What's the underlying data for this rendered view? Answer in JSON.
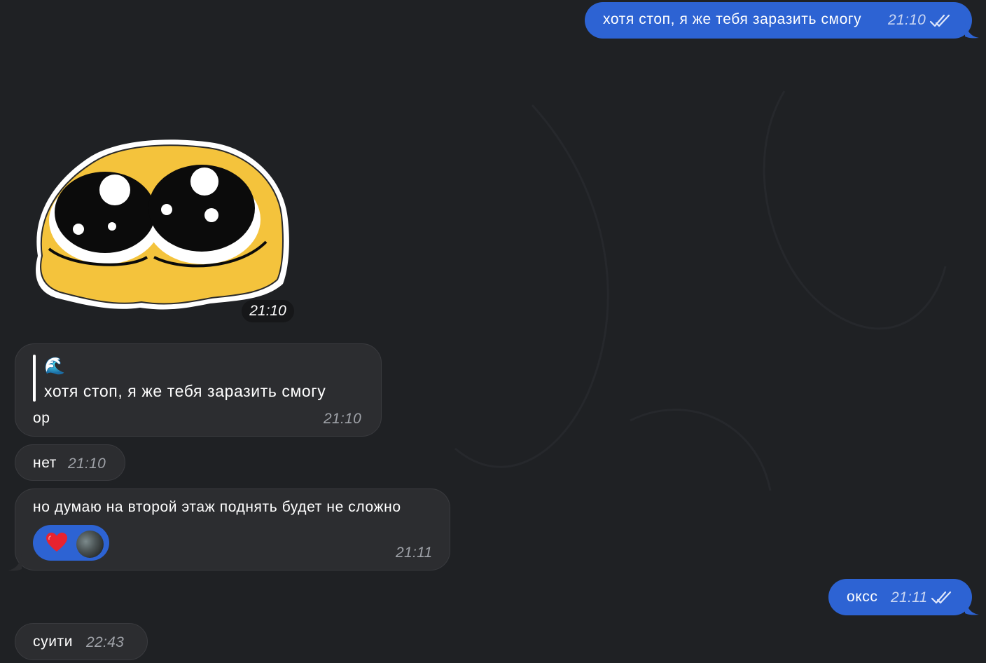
{
  "chat": {
    "colors": {
      "background": "#1f2124",
      "outgoing_bubble": "#2d63d3",
      "incoming_bubble": "#2c2d30",
      "reaction_pill": "#2d63d3"
    },
    "messages": [
      {
        "direction": "outgoing",
        "text": "хотя стоп, я же тебя заразить смогу",
        "time": "21:10",
        "status": "read-double-check"
      },
      {
        "direction": "incoming",
        "type": "sticker",
        "sticker": "yellow-blob-big-eyes",
        "time": "21:10"
      },
      {
        "direction": "incoming",
        "reply": {
          "icon": "🌊",
          "quoted_text": "хотя стоп, я же тебя заразить смогу"
        },
        "text": "ор",
        "time": "21:10"
      },
      {
        "direction": "incoming",
        "text": "нет",
        "time": "21:10"
      },
      {
        "direction": "incoming",
        "text": "но думаю на второй этаж поднять будет не сложно",
        "time": "21:11",
        "reaction": {
          "emoji": "heart-icon",
          "by": "avatar"
        }
      },
      {
        "direction": "outgoing",
        "text": "оксс",
        "time": "21:11",
        "status": "read-double-check"
      },
      {
        "direction": "incoming",
        "text": "суити",
        "time": "22:43"
      }
    ]
  }
}
